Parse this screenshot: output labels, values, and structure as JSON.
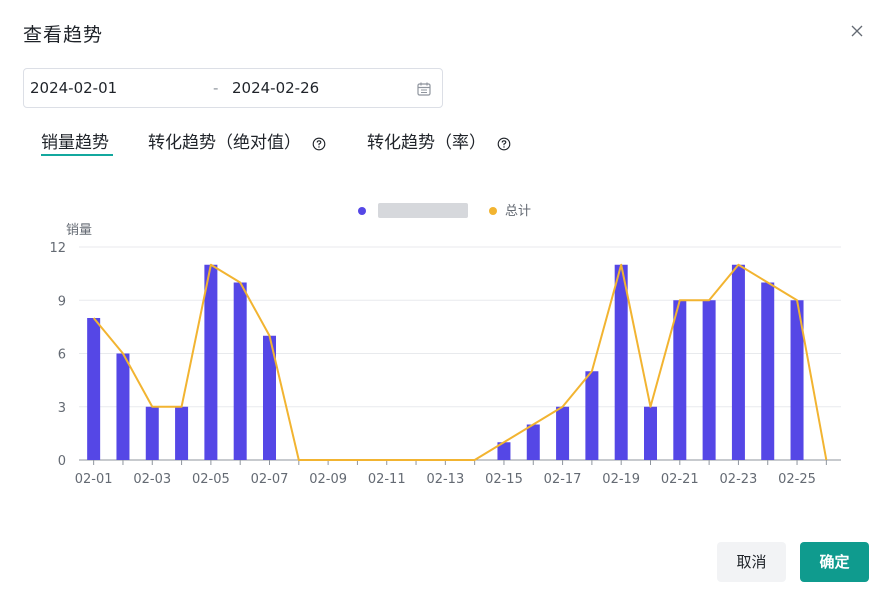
{
  "dialog": {
    "title": "查看趋势",
    "close_icon": "close-icon"
  },
  "date_range": {
    "start": "2024-02-01",
    "separator": "-",
    "end": "2024-02-26",
    "icon": "calendar-icon"
  },
  "tabs": [
    {
      "label": "销量趋势",
      "active": true,
      "help": false
    },
    {
      "label": "转化趋势（绝对值）",
      "active": false,
      "help": true
    },
    {
      "label": "转化趋势（率）",
      "active": false,
      "help": true
    }
  ],
  "buttons": {
    "cancel": "取消",
    "ok": "确定"
  },
  "colors": {
    "accent": "#13a89e",
    "bar": "#5547e6",
    "line": "#f2b431",
    "ok_button": "#0f9b8e"
  },
  "chart_data": {
    "type": "bar",
    "ylabel": "销量",
    "ylim": [
      0,
      12
    ],
    "yticks": [
      0,
      3,
      6,
      9,
      12
    ],
    "grid": true,
    "legend_position": "top-center",
    "categories": [
      "02-01",
      "02-02",
      "02-03",
      "02-04",
      "02-05",
      "02-06",
      "02-07",
      "02-08",
      "02-09",
      "02-10",
      "02-11",
      "02-12",
      "02-13",
      "02-14",
      "02-15",
      "02-16",
      "02-17",
      "02-18",
      "02-19",
      "02-20",
      "02-21",
      "02-22",
      "02-23",
      "02-24",
      "02-25",
      "02-26"
    ],
    "xtick_labels": [
      "02-01",
      "02-03",
      "02-05",
      "02-07",
      "02-09",
      "02-11",
      "02-13",
      "02-15",
      "02-17",
      "02-19",
      "02-21",
      "02-23",
      "02-25"
    ],
    "series": [
      {
        "name": "",
        "type": "bar",
        "values": [
          8,
          6,
          3,
          3,
          11,
          10,
          7,
          0,
          0,
          0,
          0,
          0,
          0,
          0,
          1,
          2,
          3,
          5,
          11,
          3,
          9,
          9,
          11,
          10,
          9,
          0
        ]
      },
      {
        "name": "总计",
        "type": "line",
        "values": [
          8,
          6,
          3,
          3,
          11,
          10,
          7,
          0,
          0,
          0,
          0,
          0,
          0,
          0,
          1,
          2,
          3,
          5,
          11,
          3,
          9,
          9,
          11,
          10,
          9,
          0
        ]
      }
    ]
  }
}
